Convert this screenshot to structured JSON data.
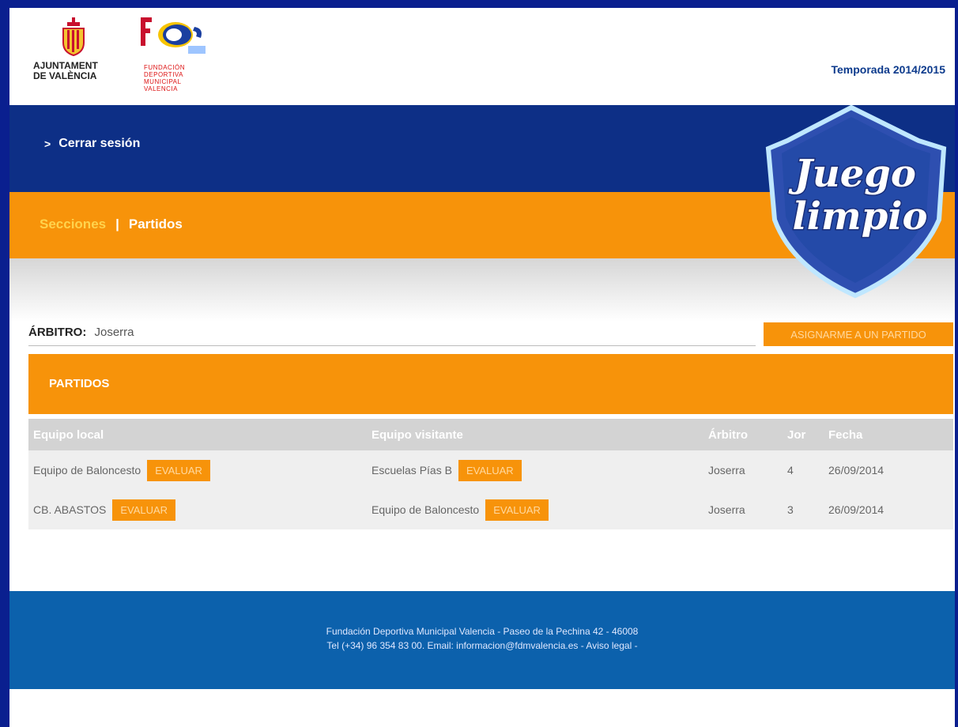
{
  "header": {
    "ajuntament_line1": "AJUNTAMENT",
    "ajuntament_line2": "DE VALÈNCIA",
    "fdm_line1": "FUNDACIÓN",
    "fdm_line2": "DEPORTIVA",
    "fdm_line3": "MUNICIPAL",
    "fdm_line4": "VALENCIA",
    "season": "Temporada 2014/2015"
  },
  "topbar": {
    "logout_label": "Cerrar sesión"
  },
  "nav": {
    "secciones": "Secciones",
    "separator": "|",
    "partidos": "Partidos"
  },
  "badge": {
    "line1": "Juego",
    "line2": "limpio"
  },
  "referee": {
    "label": "ÁRBITRO:",
    "name": "Joserra",
    "assign_button": "ASIGNARME A UN PARTIDO"
  },
  "panel": {
    "title": "PARTIDOS",
    "columns": [
      "Equipo local",
      "Equipo visitante",
      "Árbitro",
      "Jor",
      "Fecha"
    ],
    "evaluate_label": "EVALUAR",
    "rows": [
      {
        "local": "Equipo de Baloncesto",
        "visitor": "Escuelas Pías B",
        "referee": "Joserra",
        "round": "4",
        "date": "26/09/2014"
      },
      {
        "local": "CB. ABASTOS",
        "visitor": "Equipo de Baloncesto",
        "referee": "Joserra",
        "round": "3",
        "date": "26/09/2014"
      }
    ]
  },
  "footer": {
    "line1": "Fundación Deportiva Municipal Valencia - Paseo de la Pechina 42 - 46008",
    "line2": "Tel (+34) 96 354 83 00. Email: informacion@fdmvalencia.es - Aviso legal -"
  },
  "colors": {
    "navy": "#0d2f86",
    "orange": "#f7930a",
    "footer_blue": "#0c61ac"
  }
}
